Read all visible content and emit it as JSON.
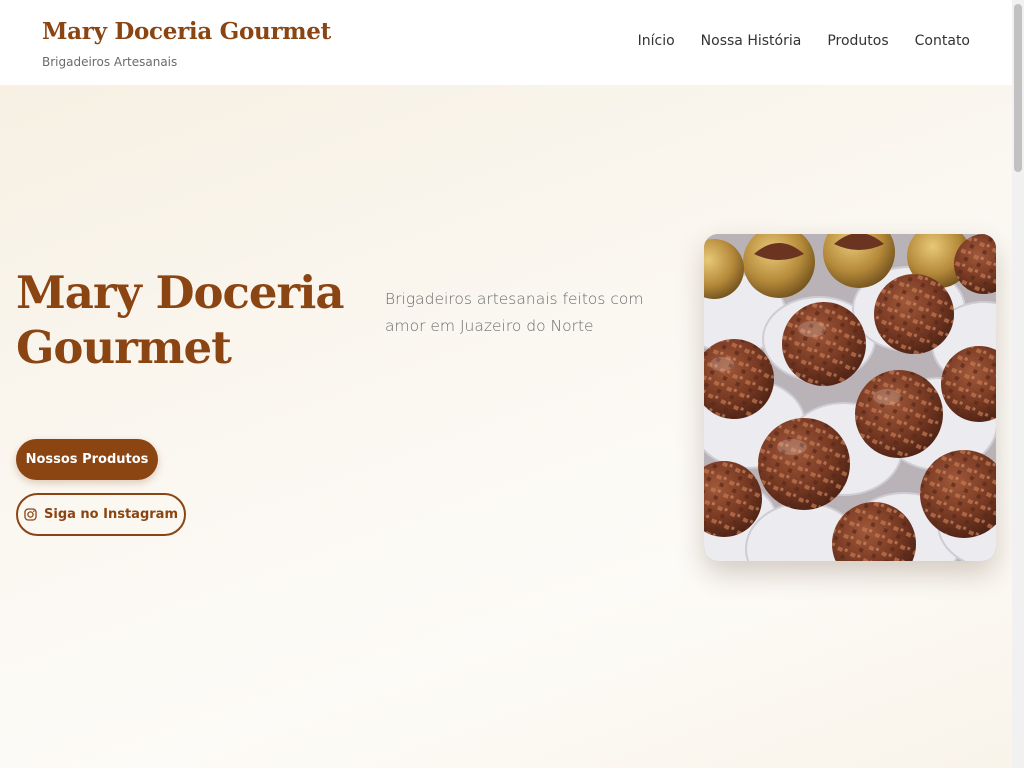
{
  "header": {
    "brand_title": "Mary Doceria Gourmet",
    "brand_tagline": "Brigadeiros Artesanais",
    "nav": [
      {
        "label": "Início"
      },
      {
        "label": "Nossa História"
      },
      {
        "label": "Produtos"
      },
      {
        "label": "Contato"
      }
    ]
  },
  "hero": {
    "title": "Mary Doceria Gourmet",
    "subtitle": "Brigadeiros artesanais feitos com amor em Juazeiro do Norte",
    "primary_button": "Nossos Produtos",
    "instagram_button": "Siga no Instagram",
    "image_subject": "brigadeiros",
    "icons": [
      "instagram-icon"
    ]
  },
  "colors": {
    "brand": "#8b4513",
    "hero_bg": "#faf6ee",
    "header_bg": "#ffffff",
    "text": "#333333",
    "muted_text": "#6b6b6b"
  }
}
